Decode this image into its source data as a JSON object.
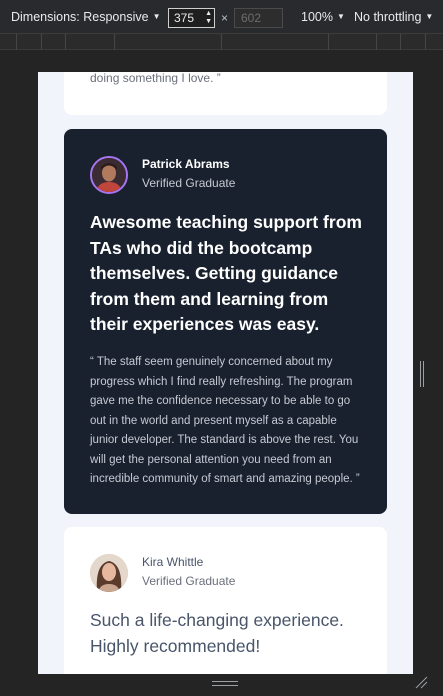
{
  "toolbar": {
    "dimensions_label": "Dimensions: Responsive",
    "width_value": "375",
    "height_placeholder": "602",
    "times": "×",
    "zoom_label": "100%",
    "throttle_label": "No throttling"
  },
  "page": {
    "top_card": {
      "quote_tail": "doing something I love. ”"
    },
    "featured": {
      "name": "Patrick Abrams",
      "role": "Verified Graduate",
      "headline": "Awesome teaching support from TAs who did the bootcamp themselves. Getting guidance from them and learning from their experiences was easy.",
      "quote": "“ The staff seem genuinely concerned about my progress which I find really refreshing. The program gave me the confidence necessary to be able to go out in the world and present myself as a capable junior developer. The standard is above the rest. You will get the personal attention you need from an incredible community of smart and amazing people. ”"
    },
    "second": {
      "name": "Kira Whittle",
      "role": "Verified Graduate",
      "headline": "Such a life-changing experience. Highly recommended!"
    }
  },
  "icons": [
    "caret-down-icon",
    "spinner-icon",
    "side-resize-handle-icon",
    "bottom-resize-handle-icon",
    "corner-resize-handle-icon"
  ],
  "colors": {
    "featured_card": "#19212e",
    "avatar_ring": "#a775f1",
    "viewport_bg": "#f2f4fb",
    "heading_grey": "#48556a"
  }
}
